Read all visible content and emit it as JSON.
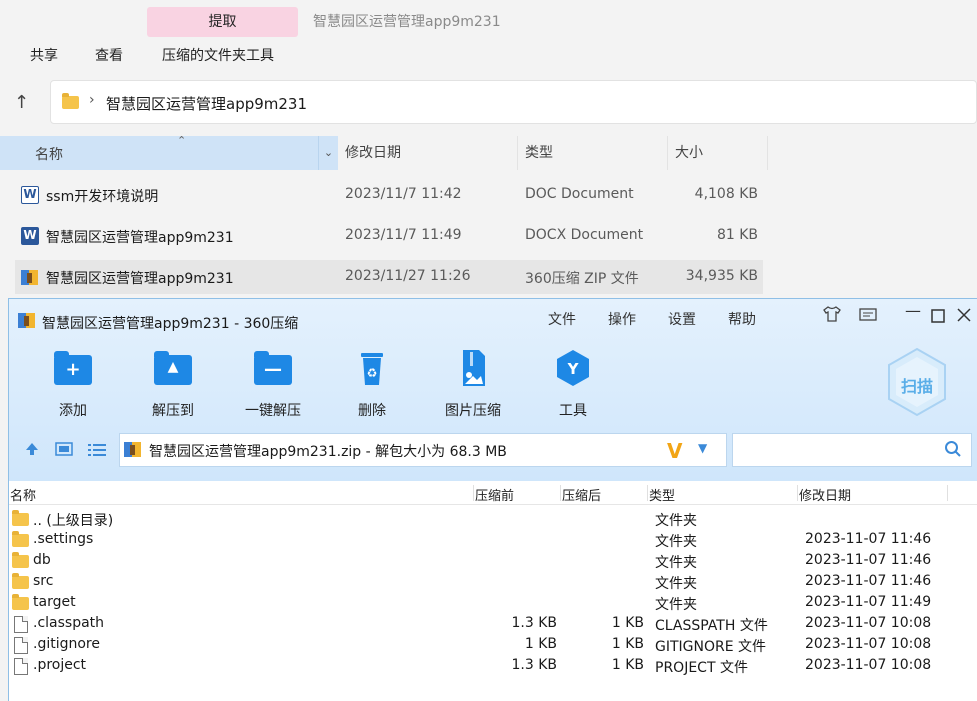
{
  "explorer": {
    "context_tab": "提取",
    "context_title": "智慧园区运营管理app9m231",
    "ribbon": [
      "共享",
      "查看",
      "压缩的文件夹工具"
    ],
    "address": "智慧园区运营管理app9m231",
    "columns": {
      "name": "名称",
      "date": "修改日期",
      "type": "类型",
      "size": "大小"
    },
    "files": [
      {
        "name": "ssm开发环境说明",
        "date": "2023/11/7 11:42",
        "type": "DOC Document",
        "size": "4,108 KB",
        "icon": "word-doc-icon"
      },
      {
        "name": "智慧园区运营管理app9m231",
        "date": "2023/11/7 11:49",
        "type": "DOCX Document",
        "size": "81 KB",
        "icon": "word-docx-icon"
      },
      {
        "name": "智慧园区运营管理app9m231",
        "date": "2023/11/27 11:26",
        "type": "360压缩 ZIP 文件",
        "size": "34,935 KB",
        "icon": "zip-icon"
      }
    ]
  },
  "zip": {
    "title": "智慧园区运营管理app9m231 - 360压缩",
    "menu": [
      "文件",
      "操作",
      "设置",
      "帮助"
    ],
    "tools": [
      "添加",
      "解压到",
      "一键解压",
      "删除",
      "图片压缩",
      "工具"
    ],
    "scan_label": "扫描",
    "path": "智慧园区运营管理app9m231.zip - 解包大小为 68.3 MB",
    "columns": {
      "name": "名称",
      "before": "压缩前",
      "after": "压缩后",
      "type": "类型",
      "date": "修改日期"
    },
    "rows": [
      {
        "name": ".. (上级目录)",
        "before": "",
        "after": "",
        "type": "文件夹",
        "date": "",
        "kind": "folder"
      },
      {
        "name": ".settings",
        "before": "",
        "after": "",
        "type": "文件夹",
        "date": "2023-11-07 11:46",
        "kind": "folder"
      },
      {
        "name": "db",
        "before": "",
        "after": "",
        "type": "文件夹",
        "date": "2023-11-07 11:46",
        "kind": "folder"
      },
      {
        "name": "src",
        "before": "",
        "after": "",
        "type": "文件夹",
        "date": "2023-11-07 11:46",
        "kind": "folder"
      },
      {
        "name": "target",
        "before": "",
        "after": "",
        "type": "文件夹",
        "date": "2023-11-07 11:49",
        "kind": "folder"
      },
      {
        "name": ".classpath",
        "before": "1.3 KB",
        "after": "1 KB",
        "type": "CLASSPATH 文件",
        "date": "2023-11-07 10:08",
        "kind": "file"
      },
      {
        "name": ".gitignore",
        "before": "1 KB",
        "after": "1 KB",
        "type": "GITIGNORE 文件",
        "date": "2023-11-07 10:08",
        "kind": "file"
      },
      {
        "name": ".project",
        "before": "1.3 KB",
        "after": "1 KB",
        "type": "PROJECT 文件",
        "date": "2023-11-07 10:08",
        "kind": "file"
      }
    ]
  }
}
